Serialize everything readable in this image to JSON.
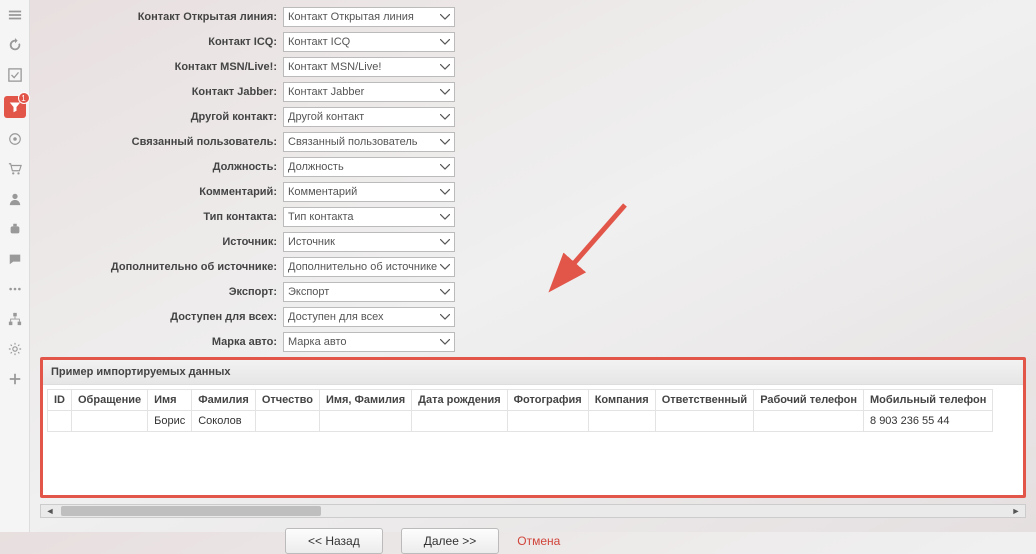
{
  "sidebar": {
    "badge_count": "1"
  },
  "fields": [
    {
      "label": "Контакт Открытая линия:",
      "value": "Контакт Открытая линия"
    },
    {
      "label": "Контакт ICQ:",
      "value": "Контакт ICQ"
    },
    {
      "label": "Контакт MSN/Live!:",
      "value": "Контакт MSN/Live!"
    },
    {
      "label": "Контакт Jabber:",
      "value": "Контакт Jabber"
    },
    {
      "label": "Другой контакт:",
      "value": "Другой контакт"
    },
    {
      "label": "Связанный пользователь:",
      "value": "Связанный пользователь"
    },
    {
      "label": "Должность:",
      "value": "Должность"
    },
    {
      "label": "Комментарий:",
      "value": "Комментарий"
    },
    {
      "label": "Тип контакта:",
      "value": "Тип контакта"
    },
    {
      "label": "Источник:",
      "value": "Источник"
    },
    {
      "label": "Дополнительно об источнике:",
      "value": "Дополнительно об источнике"
    },
    {
      "label": "Экспорт:",
      "value": "Экспорт"
    },
    {
      "label": "Доступен для всех:",
      "value": "Доступен для всех"
    },
    {
      "label": "Марка авто:",
      "value": "Марка авто"
    }
  ],
  "preview": {
    "title": "Пример импортируемых данных",
    "columns": [
      "ID",
      "Обращение",
      "Имя",
      "Фамилия",
      "Отчество",
      "Имя, Фамилия",
      "Дата рождения",
      "Фотография",
      "Компания",
      "Ответственный",
      "Рабочий телефон",
      "Мобильный телефон"
    ],
    "rows": [
      [
        "",
        "",
        "Борис",
        "Соколов",
        "",
        "",
        "",
        "",
        "",
        "",
        "",
        "8 903 236 55 44"
      ]
    ]
  },
  "buttons": {
    "back": "<< Назад",
    "next": "Далее >>",
    "cancel": "Отмена"
  }
}
